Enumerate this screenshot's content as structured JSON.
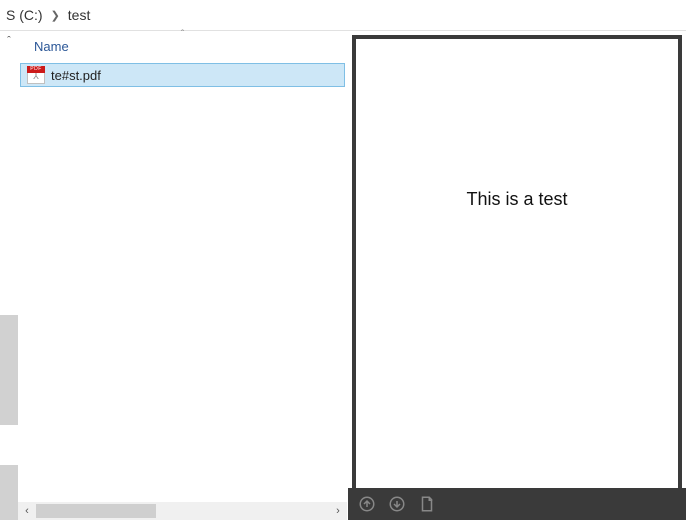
{
  "breadcrumb": {
    "drive": "S (C:)",
    "folder": "test"
  },
  "column_header": {
    "name": "Name"
  },
  "files": [
    {
      "name": "te#st.pdf",
      "icon_tag": "PDF"
    }
  ],
  "preview": {
    "content": "This is a test"
  },
  "colors": {
    "selection_bg": "#cde7f7",
    "selection_border": "#7fbfe5",
    "toolbar_bg": "#3a3a3a",
    "header_text": "#2b5797"
  }
}
